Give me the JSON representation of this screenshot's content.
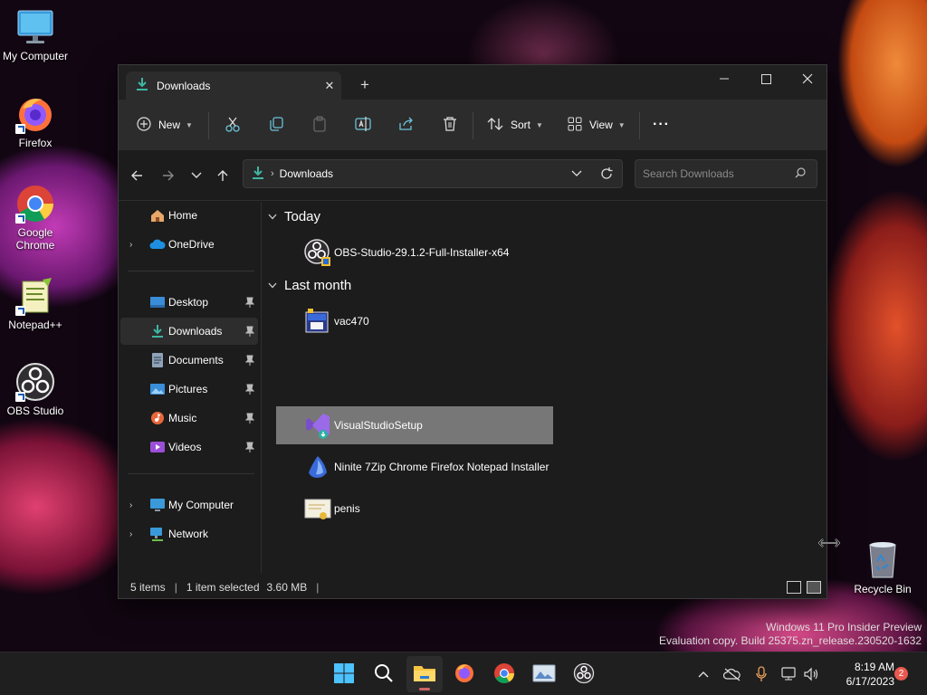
{
  "desktop": {
    "icons": [
      {
        "label": "My Computer"
      },
      {
        "label": "Firefox"
      },
      {
        "label": "Google Chrome"
      },
      {
        "label": "Notepad++"
      },
      {
        "label": "OBS Studio"
      }
    ],
    "recycle_bin": "Recycle Bin"
  },
  "window": {
    "tab_title": "Downloads",
    "new_tab": "+",
    "toolbar": {
      "new_label": "New",
      "sort_label": "Sort",
      "view_label": "View",
      "more_label": "···"
    },
    "address": {
      "crumb": "Downloads"
    },
    "search": {
      "placeholder": "Search Downloads"
    },
    "sidebar": {
      "items": [
        {
          "label": "Home"
        },
        {
          "label": "OneDrive"
        },
        {
          "label": "Desktop"
        },
        {
          "label": "Downloads"
        },
        {
          "label": "Documents"
        },
        {
          "label": "Pictures"
        },
        {
          "label": "Music"
        },
        {
          "label": "Videos"
        },
        {
          "label": "My Computer"
        },
        {
          "label": "Network"
        }
      ]
    },
    "groups": [
      {
        "title": "Today",
        "files": [
          {
            "name": "OBS-Studio-29.1.2-Full-Installer-x64"
          }
        ]
      },
      {
        "title": "Last month",
        "files": [
          {
            "name": "vac470"
          },
          {
            "name": "VisualStudioSetup"
          },
          {
            "name": "Ninite 7Zip Chrome Firefox Notepad Installer"
          },
          {
            "name": "penis"
          }
        ]
      }
    ],
    "status": {
      "items": "5 items",
      "selected": "1 item selected",
      "size": "3.60 MB",
      "trailing_bar": "|"
    }
  },
  "watermark": {
    "line1": "Windows 11 Pro Insider Preview",
    "line2": "Evaluation copy. Build 25375.zn_release.230520-1632"
  },
  "taskbar": {
    "time": "8:19 AM",
    "date": "6/17/2023",
    "notifications": "2"
  },
  "colors": {
    "window_bg": "#1c1c1c",
    "toolbar_bg": "#2c2c2c",
    "selection": "#777777",
    "accent_download": "#3fb5a3"
  }
}
